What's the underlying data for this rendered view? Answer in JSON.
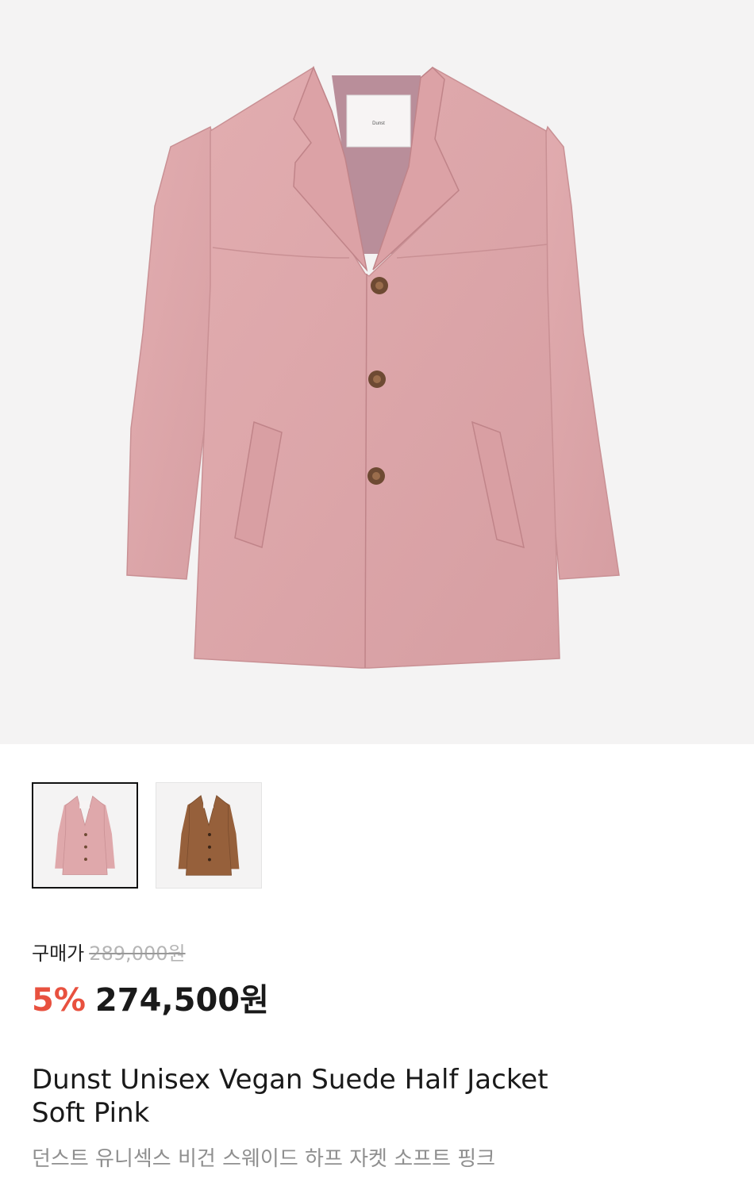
{
  "product": {
    "image_icon": "jacket-image",
    "colors": {
      "main_jacket": "#dfa8ab",
      "alt_jacket": "#96603b",
      "discount_red": "#e8513f"
    },
    "thumbnails": [
      {
        "color_name": "Soft Pink",
        "selected": true
      },
      {
        "color_name": "Brown",
        "selected": false
      }
    ],
    "price_label": "구매가",
    "original_price": "289,000원",
    "discount": "5%",
    "sale_price": "274,500원",
    "title_en_line1": "Dunst Unisex Vegan Suede Half Jacket",
    "title_en_line2": "Soft Pink",
    "title_ko": "던스트 유니섹스 비건 스웨이드 하프 자켓 소프트 핑크"
  }
}
